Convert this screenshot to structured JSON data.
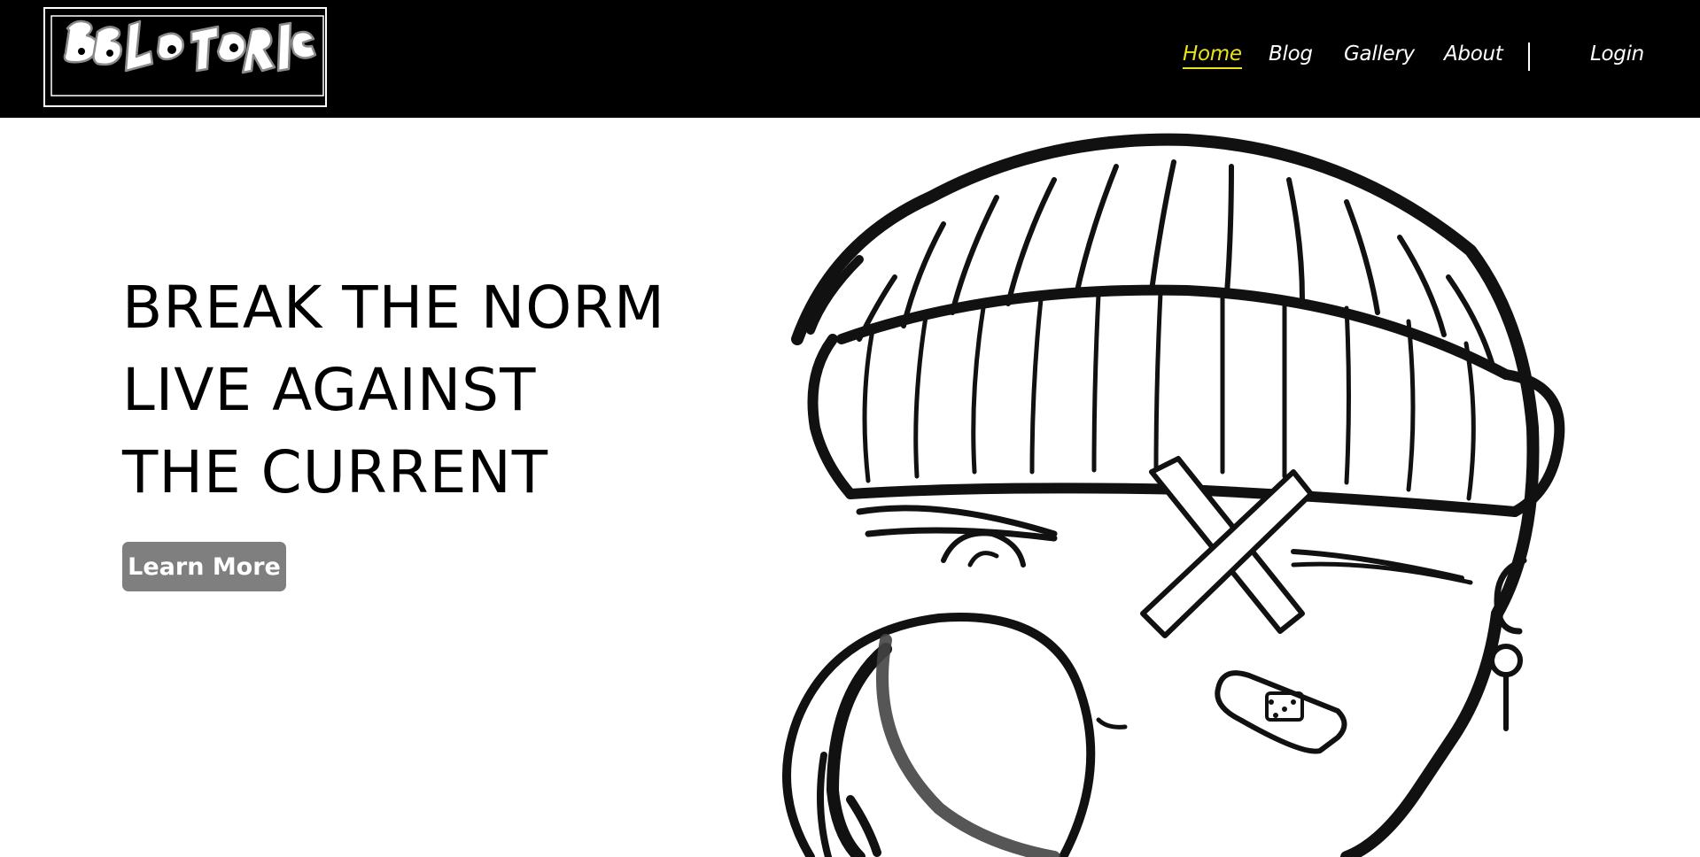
{
  "brand": {
    "logo_text": "REBELSTORIE",
    "logo_icon": "graffiti-logo"
  },
  "nav": {
    "items": [
      {
        "label": "Home",
        "active": true
      },
      {
        "label": "Blog",
        "active": false
      },
      {
        "label": "Gallery",
        "active": false
      },
      {
        "label": "About",
        "active": false
      }
    ],
    "login_label": "Login"
  },
  "hero": {
    "headline_lines": [
      "BREAK THE NORM",
      "LIVE AGAINST",
      "THE CURRENT"
    ],
    "cta_label": "Learn More",
    "illustration_icon": "beanie-character-illustration"
  },
  "colors": {
    "nav_background": "#000000",
    "active_link": "#e8e21a",
    "link": "#ffffff",
    "cta_background": "#7f7f7f",
    "cta_text": "#ffffff"
  }
}
